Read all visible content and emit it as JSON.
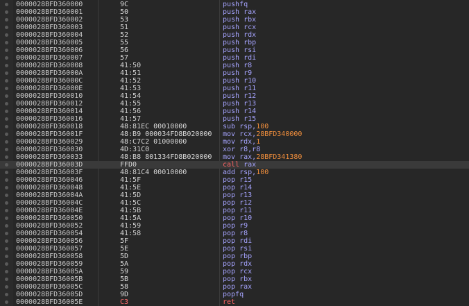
{
  "current_index": 21,
  "rows": [
    {
      "addr": "0000028BFD360000",
      "bytes": "9C",
      "mnemonic": "pushfq",
      "operands": []
    },
    {
      "addr": "0000028BFD360001",
      "bytes": "50",
      "mnemonic": "push",
      "operands": [
        {
          "t": "rax",
          "k": "reg"
        }
      ]
    },
    {
      "addr": "0000028BFD360002",
      "bytes": "53",
      "mnemonic": "push",
      "operands": [
        {
          "t": "rbx",
          "k": "reg"
        }
      ]
    },
    {
      "addr": "0000028BFD360003",
      "bytes": "51",
      "mnemonic": "push",
      "operands": [
        {
          "t": "rcx",
          "k": "reg"
        }
      ]
    },
    {
      "addr": "0000028BFD360004",
      "bytes": "52",
      "mnemonic": "push",
      "operands": [
        {
          "t": "rdx",
          "k": "reg"
        }
      ]
    },
    {
      "addr": "0000028BFD360005",
      "bytes": "55",
      "mnemonic": "push",
      "operands": [
        {
          "t": "rbp",
          "k": "reg"
        }
      ]
    },
    {
      "addr": "0000028BFD360006",
      "bytes": "56",
      "mnemonic": "push",
      "operands": [
        {
          "t": "rsi",
          "k": "reg"
        }
      ]
    },
    {
      "addr": "0000028BFD360007",
      "bytes": "57",
      "mnemonic": "push",
      "operands": [
        {
          "t": "rdi",
          "k": "reg"
        }
      ]
    },
    {
      "addr": "0000028BFD360008",
      "bytes": "41:50",
      "mnemonic": "push",
      "operands": [
        {
          "t": "r8",
          "k": "reg"
        }
      ]
    },
    {
      "addr": "0000028BFD36000A",
      "bytes": "41:51",
      "mnemonic": "push",
      "operands": [
        {
          "t": "r9",
          "k": "reg"
        }
      ]
    },
    {
      "addr": "0000028BFD36000C",
      "bytes": "41:52",
      "mnemonic": "push",
      "operands": [
        {
          "t": "r10",
          "k": "reg"
        }
      ]
    },
    {
      "addr": "0000028BFD36000E",
      "bytes": "41:53",
      "mnemonic": "push",
      "operands": [
        {
          "t": "r11",
          "k": "reg"
        }
      ]
    },
    {
      "addr": "0000028BFD360010",
      "bytes": "41:54",
      "mnemonic": "push",
      "operands": [
        {
          "t": "r12",
          "k": "reg"
        }
      ]
    },
    {
      "addr": "0000028BFD360012",
      "bytes": "41:55",
      "mnemonic": "push",
      "operands": [
        {
          "t": "r13",
          "k": "reg"
        }
      ]
    },
    {
      "addr": "0000028BFD360014",
      "bytes": "41:56",
      "mnemonic": "push",
      "operands": [
        {
          "t": "r14",
          "k": "reg"
        }
      ]
    },
    {
      "addr": "0000028BFD360016",
      "bytes": "41:57",
      "mnemonic": "push",
      "operands": [
        {
          "t": "r15",
          "k": "reg"
        }
      ]
    },
    {
      "addr": "0000028BFD360018",
      "bytes": "48:81EC 00010000",
      "mnemonic": "sub",
      "operands": [
        {
          "t": "rsp",
          "k": "reg"
        },
        {
          "t": ",",
          "k": "sep"
        },
        {
          "t": "100",
          "k": "num"
        }
      ]
    },
    {
      "addr": "0000028BFD36001F",
      "bytes": "48:B9 000034FD8B020000",
      "mnemonic": "mov",
      "operands": [
        {
          "t": "rcx",
          "k": "reg"
        },
        {
          "t": ",",
          "k": "sep"
        },
        {
          "t": "28BFD340000",
          "k": "num"
        }
      ]
    },
    {
      "addr": "0000028BFD360029",
      "bytes": "48:C7C2 01000000",
      "mnemonic": "mov",
      "operands": [
        {
          "t": "rdx",
          "k": "reg"
        },
        {
          "t": ",",
          "k": "sep"
        },
        {
          "t": "1",
          "k": "num"
        }
      ]
    },
    {
      "addr": "0000028BFD360030",
      "bytes": "4D:31C0",
      "mnemonic": "xor",
      "operands": [
        {
          "t": "r8",
          "k": "reg"
        },
        {
          "t": ",",
          "k": "sep"
        },
        {
          "t": "r8",
          "k": "reg"
        }
      ]
    },
    {
      "addr": "0000028BFD360033",
      "bytes": "48:B8 801334FD8B020000",
      "mnemonic": "mov",
      "operands": [
        {
          "t": "rax",
          "k": "reg"
        },
        {
          "t": ",",
          "k": "sep"
        },
        {
          "t": "28BFD341380",
          "k": "num"
        }
      ]
    },
    {
      "addr": "0000028BFD36003D",
      "bytes": "FFD0",
      "mnemonic": "call",
      "kind": "call",
      "operands": [
        {
          "t": "rax",
          "k": "reg"
        }
      ]
    },
    {
      "addr": "0000028BFD36003F",
      "bytes": "48:81C4 00010000",
      "mnemonic": "add",
      "operands": [
        {
          "t": "rsp",
          "k": "reg"
        },
        {
          "t": ",",
          "k": "sep"
        },
        {
          "t": "100",
          "k": "num"
        }
      ]
    },
    {
      "addr": "0000028BFD360046",
      "bytes": "41:5F",
      "mnemonic": "pop",
      "operands": [
        {
          "t": "r15",
          "k": "reg"
        }
      ]
    },
    {
      "addr": "0000028BFD360048",
      "bytes": "41:5E",
      "mnemonic": "pop",
      "operands": [
        {
          "t": "r14",
          "k": "reg"
        }
      ]
    },
    {
      "addr": "0000028BFD36004A",
      "bytes": "41:5D",
      "mnemonic": "pop",
      "operands": [
        {
          "t": "r13",
          "k": "reg"
        }
      ]
    },
    {
      "addr": "0000028BFD36004C",
      "bytes": "41:5C",
      "mnemonic": "pop",
      "operands": [
        {
          "t": "r12",
          "k": "reg"
        }
      ]
    },
    {
      "addr": "0000028BFD36004E",
      "bytes": "41:5B",
      "mnemonic": "pop",
      "operands": [
        {
          "t": "r11",
          "k": "reg"
        }
      ]
    },
    {
      "addr": "0000028BFD360050",
      "bytes": "41:5A",
      "mnemonic": "pop",
      "operands": [
        {
          "t": "r10",
          "k": "reg"
        }
      ]
    },
    {
      "addr": "0000028BFD360052",
      "bytes": "41:59",
      "mnemonic": "pop",
      "operands": [
        {
          "t": "r9",
          "k": "reg"
        }
      ]
    },
    {
      "addr": "0000028BFD360054",
      "bytes": "41:58",
      "mnemonic": "pop",
      "operands": [
        {
          "t": "r8",
          "k": "reg"
        }
      ]
    },
    {
      "addr": "0000028BFD360056",
      "bytes": "5F",
      "mnemonic": "pop",
      "operands": [
        {
          "t": "rdi",
          "k": "reg"
        }
      ]
    },
    {
      "addr": "0000028BFD360057",
      "bytes": "5E",
      "mnemonic": "pop",
      "operands": [
        {
          "t": "rsi",
          "k": "reg"
        }
      ]
    },
    {
      "addr": "0000028BFD360058",
      "bytes": "5D",
      "mnemonic": "pop",
      "operands": [
        {
          "t": "rbp",
          "k": "reg"
        }
      ]
    },
    {
      "addr": "0000028BFD360059",
      "bytes": "5A",
      "mnemonic": "pop",
      "operands": [
        {
          "t": "rdx",
          "k": "reg"
        }
      ]
    },
    {
      "addr": "0000028BFD36005A",
      "bytes": "59",
      "mnemonic": "pop",
      "operands": [
        {
          "t": "rcx",
          "k": "reg"
        }
      ]
    },
    {
      "addr": "0000028BFD36005B",
      "bytes": "5B",
      "mnemonic": "pop",
      "operands": [
        {
          "t": "rbx",
          "k": "reg"
        }
      ]
    },
    {
      "addr": "0000028BFD36005C",
      "bytes": "58",
      "mnemonic": "pop",
      "operands": [
        {
          "t": "rax",
          "k": "reg"
        }
      ]
    },
    {
      "addr": "0000028BFD36005D",
      "bytes": "9D",
      "mnemonic": "popfq",
      "operands": []
    },
    {
      "addr": "0000028BFD36005E",
      "bytes": "C3",
      "bytes_kind": "red",
      "mnemonic": "ret",
      "kind": "ret",
      "operands": []
    }
  ]
}
